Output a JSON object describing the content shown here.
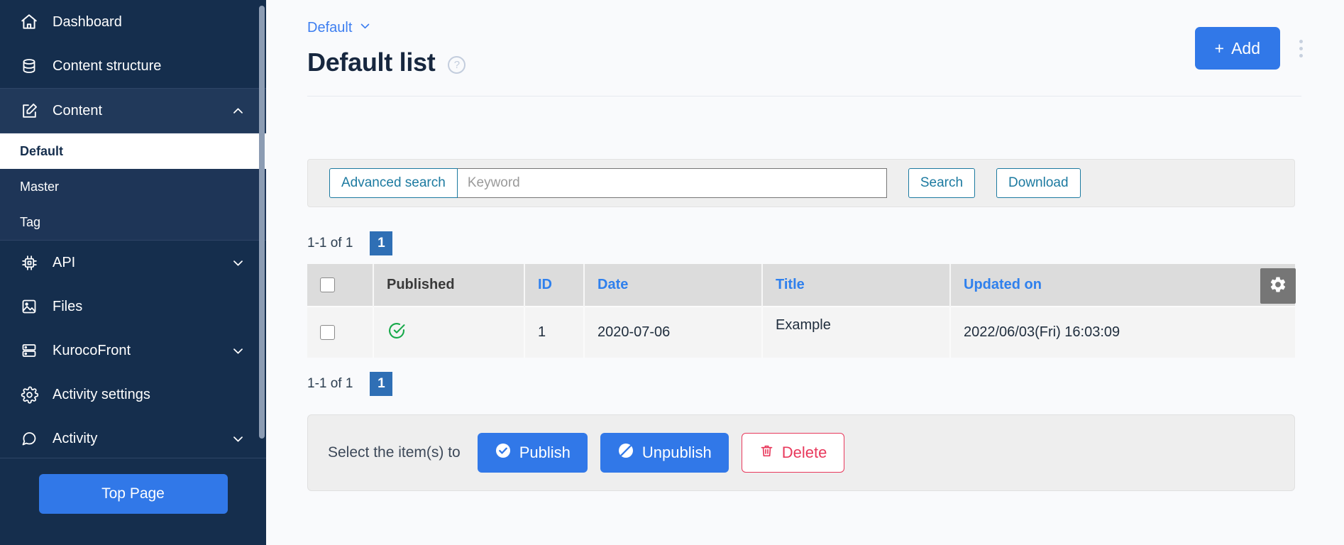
{
  "sidebar": {
    "items": [
      {
        "label": "Dashboard",
        "icon": "home-icon",
        "expandable": false
      },
      {
        "label": "Content structure",
        "icon": "database-icon",
        "expandable": false
      },
      {
        "label": "Content",
        "icon": "edit-square-icon",
        "expandable": true,
        "expanded": true
      },
      {
        "label": "API",
        "icon": "chip-icon",
        "expandable": true,
        "expanded": false
      },
      {
        "label": "Files",
        "icon": "image-icon",
        "expandable": false
      },
      {
        "label": "KurocoFront",
        "icon": "server-icon",
        "expandable": true,
        "expanded": false
      },
      {
        "label": "Activity settings",
        "icon": "gear-icon",
        "expandable": false
      },
      {
        "label": "Activity",
        "icon": "chat-icon",
        "expandable": true,
        "expanded": false
      }
    ],
    "content_subitems": [
      {
        "label": "Default",
        "active": true
      },
      {
        "label": "Master",
        "active": false
      },
      {
        "label": "Tag",
        "active": false
      }
    ],
    "footer_button": "Top Page",
    "accent_color": "#3178e8",
    "bg_color": "#152e4d"
  },
  "header": {
    "breadcrumb": "Default",
    "breadcrumb_icon": "chevron-down-icon",
    "title": "Default list",
    "help_icon": "question-circle-icon",
    "add_button": "Add",
    "add_icon": "plus-icon",
    "kebab_icon": "more-vertical-icon"
  },
  "search": {
    "advanced_label": "Advanced search",
    "placeholder": "Keyword",
    "value": "",
    "search_label": "Search",
    "download_label": "Download"
  },
  "pagination": {
    "range_label": "1-1 of 1",
    "current_page": "1"
  },
  "table": {
    "settings_icon": "gear-icon",
    "columns": [
      {
        "label": "",
        "type": "checkbox",
        "sortable": false
      },
      {
        "label": "Published",
        "sortable": false
      },
      {
        "label": "ID",
        "sortable": true
      },
      {
        "label": "Date",
        "sortable": true
      },
      {
        "label": "Title",
        "sortable": true
      },
      {
        "label": "Updated on",
        "sortable": true
      }
    ],
    "rows": [
      {
        "published_icon": "check-circle-icon",
        "published_color": "#17a94a",
        "id": "1",
        "date": "2020-07-06",
        "title": "Example",
        "updated_on": "2022/06/03(Fri) 16:03:09"
      }
    ]
  },
  "actions": {
    "label": "Select the item(s) to",
    "publish": "Publish",
    "publish_icon": "check-circle-filled-icon",
    "unpublish": "Unpublish",
    "unpublish_icon": "ban-icon",
    "delete": "Delete",
    "delete_icon": "trash-icon"
  }
}
